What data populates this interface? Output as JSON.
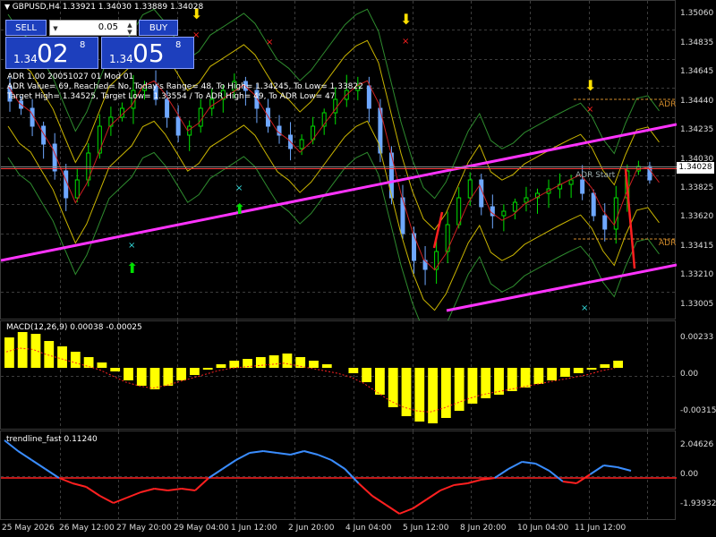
{
  "chart_header": {
    "title": "GBPUSD,H4  1.33921 1.34030 1.33889 1.34028",
    "adr_line": "ADR 1.00 20051027 01 Mod 01",
    "adr_values": "ADR Value= 69, Reached= No, Today's Range= 48, To High= 1.34245, To Low= 1.33822",
    "targets": "Target High= 1.34525, Target Low= 1.33554 / To ADR High= 49, To ADR Low= 47"
  },
  "trade_panel": {
    "sell_label": "SELL",
    "buy_label": "BUY",
    "lot_value": "0.05",
    "bid_small": "1.34",
    "bid_big": "02",
    "bid_sup": "8",
    "ask_small": "1.34",
    "ask_big": "05",
    "ask_sup": "8"
  },
  "labels": {
    "adr_high": "ADR",
    "adr_low": "ADR",
    "adr_start": "ADR Start",
    "current_price": "1.34028"
  },
  "price_axis": [
    "1.35060",
    "1.34835",
    "1.34645",
    "1.34440",
    "1.34235",
    "1.34030",
    "1.33825",
    "1.33620",
    "1.33415",
    "1.33210",
    "1.33005"
  ],
  "macd": {
    "title": "MACD(12,26,9) 0.00038 -0.00025",
    "axis": [
      "0.00233",
      "0.00",
      "-0.00315"
    ]
  },
  "trendline": {
    "title": "trendline_fast 0.11240",
    "axis": [
      "2.04626",
      "0.00",
      "-1.93932"
    ]
  },
  "time_axis": [
    "25 May 2026",
    "26 May 12:00",
    "27 May 20:00",
    "29 May 04:00",
    "1 Jun 12:00",
    "2 Jun 20:00",
    "4 Jun 04:00",
    "5 Jun 12:00",
    "8 Jun 20:00",
    "10 Jun 04:00",
    "11 Jun 12:00"
  ],
  "colors": {
    "bull": "#00e000",
    "bear": "#6fa8ff",
    "magenta": "#ff33ff",
    "macd_hist": "#ffff00",
    "signal": "#ff2222",
    "trend_up": "#3a8dff",
    "trend_down": "#ff2020"
  }
}
